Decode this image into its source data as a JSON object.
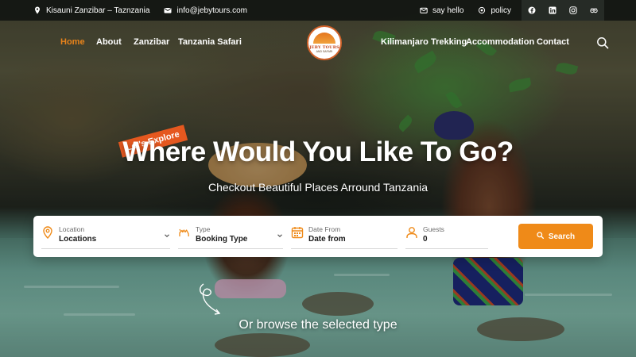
{
  "topbar": {
    "location": "Kisauni Zanzibar – Taznzania",
    "email": "info@jebytours.com",
    "say_hello": "say hello",
    "policy": "policy",
    "social": [
      "facebook-icon",
      "linkedin-icon",
      "instagram-icon",
      "tripadvisor-icon"
    ]
  },
  "nav": {
    "left": [
      "Home",
      "About",
      "Zanzibar",
      "Tanzania Safari"
    ],
    "right": [
      "Kilimanjaro Trekking",
      "Accommodation",
      "Contact"
    ],
    "active": "Home"
  },
  "logo": {
    "line1": "JEBY TOURS",
    "line2": "AND SAFARI"
  },
  "hero": {
    "badge": "Let's Explore",
    "headline": "Where Would You Like To Go?",
    "subline": "Checkout Beautiful Places Arround Tanzania"
  },
  "search": {
    "location": {
      "label": "Location",
      "value": "Locations"
    },
    "type": {
      "label": "Type",
      "value": "Booking Type"
    },
    "date": {
      "label": "Date From",
      "value": "Date from"
    },
    "guests": {
      "label": "Guests",
      "value": "0"
    },
    "button": "Search"
  },
  "browse_text": "Or browse the selected type",
  "colors": {
    "accent": "#ef8a18",
    "active_nav": "#e8831b",
    "badge": "#e5581f"
  }
}
